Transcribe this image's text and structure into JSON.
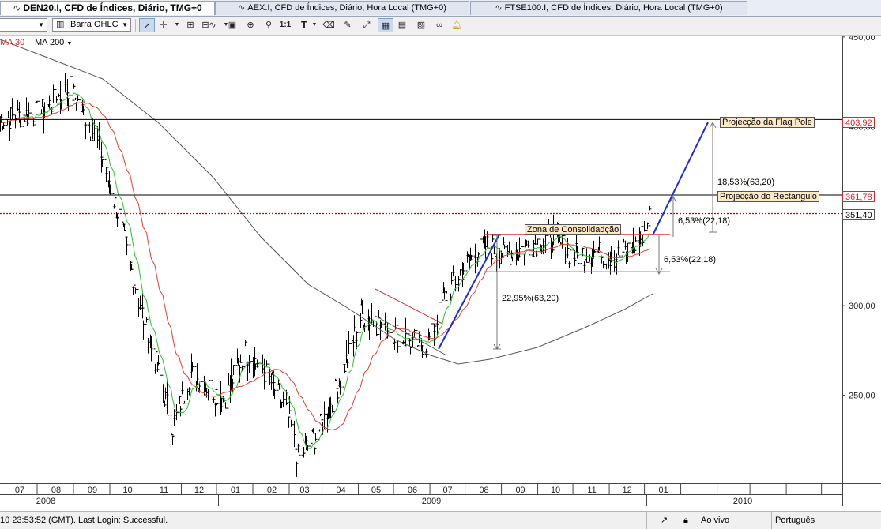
{
  "tabs": [
    {
      "label": "DEN20.I, CFD de Índices, Diário, TMG+0",
      "active": true
    },
    {
      "label": "AEX.I, CFD de Índices, Diário, Hora Local (TMG+0)",
      "active": false
    },
    {
      "label": "FTSE100.I, CFD de Índices, Diário, Hora Local (TMG+0)",
      "active": false
    }
  ],
  "toolbar": {
    "chart_type": "Barra OHLC",
    "ma_30": "MA 30",
    "ma_200": "MA 200",
    "one_to_one": "1:1"
  },
  "status": {
    "login_text": "10 23:53:52 (GMT). Last Login: Successful.",
    "mode": "Ao vivo",
    "language": "Português"
  },
  "chart_data": {
    "type": "ohlc",
    "y_ticks": [
      "450,00",
      "400,00",
      "350,00",
      "300,00",
      "250,00"
    ],
    "ylim": [
      203,
      452
    ],
    "months": [
      "07",
      "08",
      "09",
      "10",
      "11",
      "12",
      "01",
      "02",
      "03",
      "04",
      "05",
      "06",
      "07",
      "08",
      "09",
      "10",
      "11",
      "12",
      "01"
    ],
    "years": [
      "2008",
      "2009",
      "2010"
    ],
    "price_labels": {
      "flag_pole_projection": "403,92",
      "rectangle_projection": "361,78",
      "current_price": "351,40"
    },
    "annotations": {
      "flag_pole": "Projecção da Flag Pole",
      "rectangle": "Projecção do Rectangulo",
      "consolidation": "Zona de Consolidadção",
      "pct_1853": "18,53%(63,20)",
      "pct_653_a": "6,53%(22,18)",
      "pct_653_b": "6,53%(22,18)",
      "pct_2295": "22,95%(63,20)"
    },
    "levels": {
      "flag_pole": 403.92,
      "rectangle": 361.78,
      "current": 351.4,
      "consol_top": 339.6,
      "consol_bottom": 319
    },
    "ma30_color": "#e63c2c",
    "ma10_color": "#2fbf2f",
    "ma200_color": "#555555",
    "trend_color": "#1f2fbf",
    "series_anchors": {
      "x": [
        "2008-07-01",
        "2008-08-05",
        "2008-08-29",
        "2008-09-20",
        "2008-10-10",
        "2008-10-28",
        "2008-11-12",
        "2008-11-25",
        "2008-12-10",
        "2009-01-08",
        "2009-01-25",
        "2009-02-12",
        "2009-03-03",
        "2009-03-12",
        "2009-03-28",
        "2009-04-15",
        "2009-05-05",
        "2009-05-25",
        "2009-06-12",
        "2009-06-30",
        "2009-07-15",
        "2009-08-01",
        "2009-08-18",
        "2009-09-05",
        "2009-09-25",
        "2009-10-15",
        "2009-11-01",
        "2009-11-18",
        "2009-12-08",
        "2009-12-28",
        "2010-01-06"
      ],
      "close": [
        404,
        408,
        422,
        395,
        350,
        300,
        265,
        232,
        262,
        248,
        275,
        263,
        240,
        215,
        228,
        255,
        295,
        288,
        281,
        278,
        305,
        322,
        334,
        328,
        334,
        338,
        328,
        330,
        327,
        336,
        350
      ]
    }
  }
}
